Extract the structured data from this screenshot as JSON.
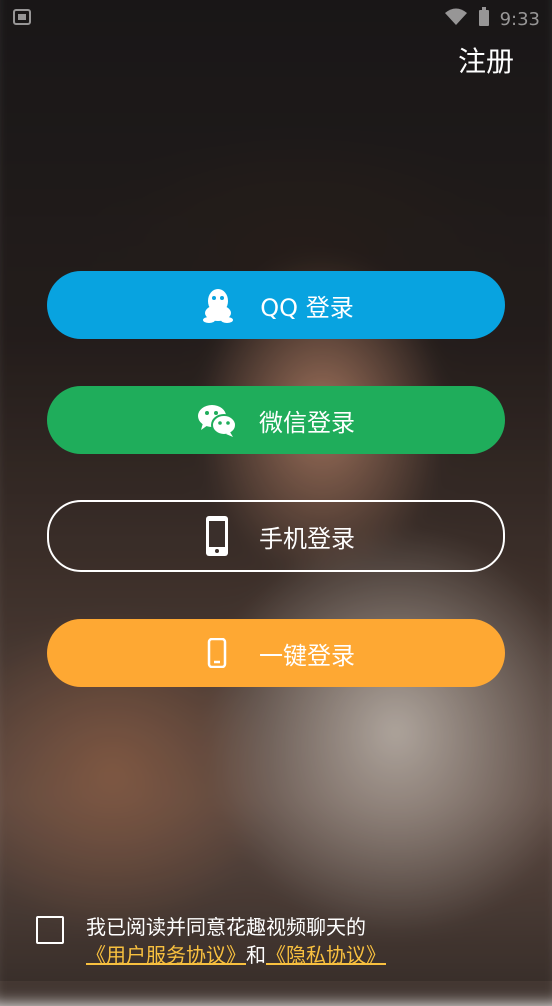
{
  "status_bar": {
    "time": "9:33"
  },
  "header": {
    "register_label": "注册"
  },
  "login_buttons": {
    "qq": {
      "label": "QQ 登录",
      "icon": "qq-penguin-icon",
      "color": "#08a3e0"
    },
    "wechat": {
      "label": "微信登录",
      "icon": "wechat-icon",
      "color": "#1fad5b"
    },
    "phone": {
      "label": "手机登录",
      "icon": "smartphone-icon"
    },
    "one_key": {
      "label": "一键登录",
      "icon": "mobile-icon",
      "color": "#fea833"
    }
  },
  "agreement": {
    "text_prefix": "我已阅读并同意花趣视频聊天的",
    "user_agreement": "《用户服务协议》",
    "conjunction": "和",
    "privacy_policy": "《隐私协议》",
    "link_color": "#f8c03f"
  }
}
